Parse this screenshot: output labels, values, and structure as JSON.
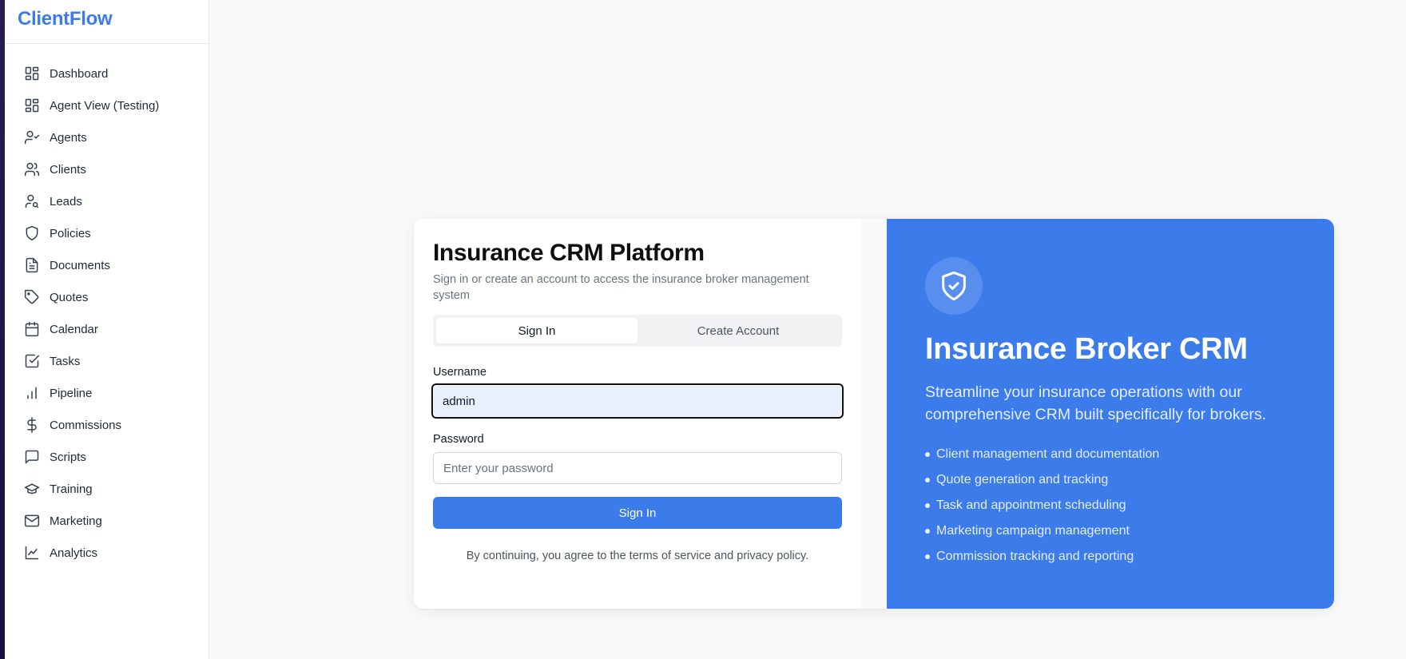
{
  "app": {
    "brand": "ClientFlow"
  },
  "sidebar": {
    "items": [
      {
        "label": "Dashboard",
        "icon": "grid-icon"
      },
      {
        "label": "Agent View (Testing)",
        "icon": "grid-icon"
      },
      {
        "label": "Agents",
        "icon": "user-check-icon"
      },
      {
        "label": "Clients",
        "icon": "users-icon"
      },
      {
        "label": "Leads",
        "icon": "user-search-icon"
      },
      {
        "label": "Policies",
        "icon": "shield-icon"
      },
      {
        "label": "Documents",
        "icon": "file-text-icon"
      },
      {
        "label": "Quotes",
        "icon": "tag-icon"
      },
      {
        "label": "Calendar",
        "icon": "calendar-icon"
      },
      {
        "label": "Tasks",
        "icon": "check-square-icon"
      },
      {
        "label": "Pipeline",
        "icon": "bar-chart-icon"
      },
      {
        "label": "Commissions",
        "icon": "dollar-icon"
      },
      {
        "label": "Scripts",
        "icon": "message-square-icon"
      },
      {
        "label": "Training",
        "icon": "graduation-cap-icon"
      },
      {
        "label": "Marketing",
        "icon": "mail-icon"
      },
      {
        "label": "Analytics",
        "icon": "line-chart-icon"
      }
    ]
  },
  "auth": {
    "title": "Insurance CRM Platform",
    "subtitle": "Sign in or create an account to access the insurance broker management system",
    "tabs": [
      {
        "label": "Sign In",
        "active": true
      },
      {
        "label": "Create Account",
        "active": false
      }
    ],
    "username": {
      "label": "Username",
      "value": "admin"
    },
    "password": {
      "label": "Password",
      "value": "",
      "placeholder": "Enter your password"
    },
    "submit_label": "Sign In",
    "terms": "By continuing, you agree to the terms of service and privacy policy."
  },
  "promo": {
    "icon": "shield-check-icon",
    "title": "Insurance Broker CRM",
    "description": "Streamline your insurance operations with our comprehensive CRM built specifically for brokers.",
    "features": [
      "Client management and documentation",
      "Quote generation and tracking",
      "Task and appointment scheduling",
      "Marketing campaign management",
      "Commission tracking and reporting"
    ]
  },
  "colors": {
    "accent": "#3b7bea",
    "focus_field_bg": "#e8f0fe"
  }
}
